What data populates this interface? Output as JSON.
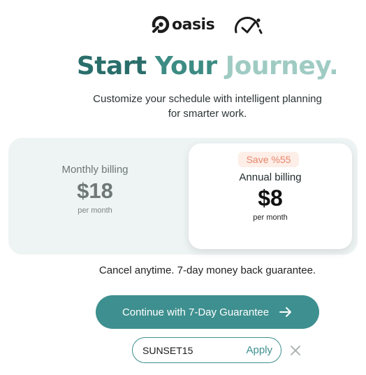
{
  "header": {
    "brand_name": "oasis",
    "brand_icon": "oasis-logo-icon",
    "secondary_icon": "gauge-icon"
  },
  "hero": {
    "title_parts": [
      "Start",
      "Your",
      "Journey."
    ],
    "title_colors": [
      "#2a6e6b",
      "#3d8c84",
      "#9fcbc3"
    ],
    "subtitle_line1": "Customize your schedule with intelligent planning",
    "subtitle_line2": "for smarter work."
  },
  "billing": {
    "monthly": {
      "label": "Monthly billing",
      "price": "$18",
      "period": "per month"
    },
    "annual": {
      "badge": "Save %55",
      "label": "Annual billing",
      "price": "$8",
      "period": "per month",
      "selected": true
    }
  },
  "guarantee_text": "Cancel anytime. 7-day money back guarantee.",
  "cta": {
    "label": "Continue with 7-Day Guarantee",
    "icon": "arrow-right-icon"
  },
  "coupon": {
    "value": "SUNSET15",
    "apply_label": "Apply",
    "close_icon": "close-icon"
  },
  "colors": {
    "accent": "#3e8f8f",
    "badge_bg": "#fdeee8",
    "badge_text": "#e8866a",
    "panel_bg": "#eef4f3"
  }
}
